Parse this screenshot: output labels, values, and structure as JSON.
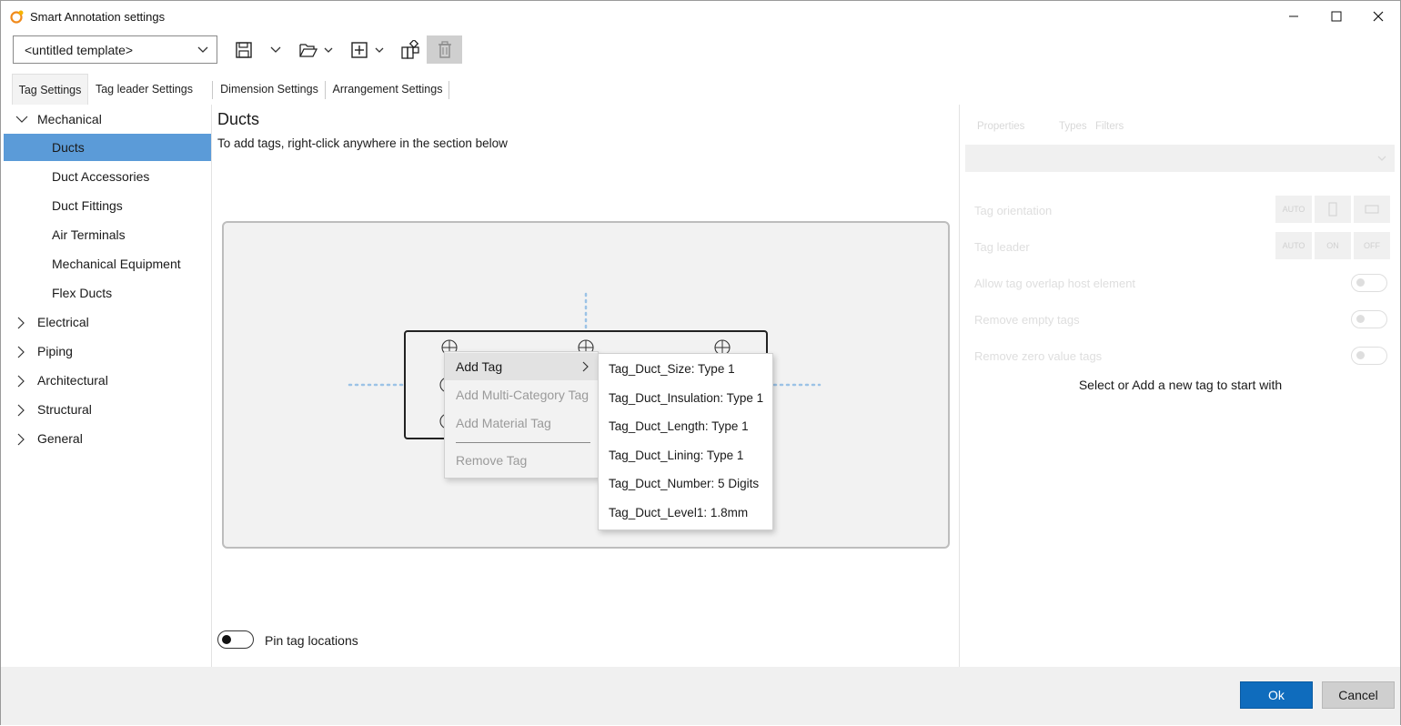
{
  "window": {
    "title": "Smart Annotation settings"
  },
  "toolbar": {
    "template_value": "<untitled template>"
  },
  "tabs": [
    {
      "label": "Tag Settings",
      "active": true
    },
    {
      "label": "Tag leader Settings",
      "active": false
    },
    {
      "label": "Dimension Settings",
      "active": false
    },
    {
      "label": "Arrangement Settings",
      "active": false
    }
  ],
  "tree": {
    "mechanical": {
      "label": "Mechanical",
      "children": [
        "Ducts",
        "Duct Accessories",
        "Duct Fittings",
        "Air Terminals",
        "Mechanical Equipment",
        "Flex Ducts"
      ],
      "selected": "Ducts"
    },
    "others": [
      "Electrical",
      "Piping",
      "Architectural",
      "Structural",
      "General"
    ]
  },
  "main": {
    "title": "Ducts",
    "hint": "To add tags, right-click anywhere in the section below",
    "pin_label": "Pin tag locations",
    "pin_enabled": false
  },
  "context_menu": {
    "items": [
      {
        "label": "Add Tag",
        "enabled": true
      },
      {
        "label": "Add Multi-Category Tag",
        "enabled": false
      },
      {
        "label": "Add Material Tag",
        "enabled": false
      },
      {
        "label": "Remove Tag",
        "enabled": false
      }
    ],
    "submenu": [
      "Tag_Duct_Size: Type 1",
      "Tag_Duct_Insulation: Type 1",
      "Tag_Duct_Length: Type 1",
      "Tag_Duct_Lining: Type 1",
      "Tag_Duct_Number: 5 Digits",
      "Tag_Duct_Level1: 1.8mm"
    ]
  },
  "right_panel": {
    "tabs": [
      "Properties",
      "Types",
      "Filters"
    ],
    "rows": [
      "Tag orientation",
      "Tag leader",
      "Allow tag overlap host element",
      "Remove empty tags",
      "Remove zero value tags"
    ],
    "orientation_options": [
      "AUTO"
    ],
    "leader_options": [
      "AUTO",
      "ON",
      "OFF"
    ],
    "empty_message": "Select or Add a new tag to start with"
  },
  "footer": {
    "ok_label": "Ok",
    "cancel_label": "Cancel"
  },
  "colors": {
    "accent": "#0f6cbd",
    "selection": "#5b9bd8",
    "guide_dots": "#9cc3e6"
  }
}
